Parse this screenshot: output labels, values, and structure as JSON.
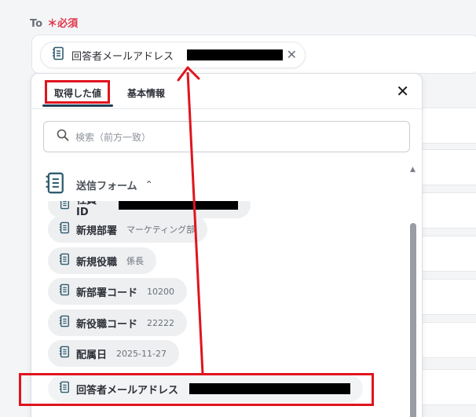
{
  "field": {
    "label": "To",
    "required": "＊必須"
  },
  "to_chip": {
    "label": "回答者メールアドレス",
    "icon": "spreadsheet-icon"
  },
  "tabs": [
    {
      "label": "取得した値"
    },
    {
      "label": "基本情報"
    }
  ],
  "search": {
    "placeholder": "検索（前方一致）"
  },
  "section": {
    "label": "送信フォーム"
  },
  "items": [
    {
      "name": "社員ID",
      "value": ""
    },
    {
      "name": "新規部署",
      "value": "マーケティング部"
    },
    {
      "name": "新規役職",
      "value": "係長"
    },
    {
      "name": "新部署コード",
      "value": "10200"
    },
    {
      "name": "新役職コード",
      "value": "22222"
    },
    {
      "name": "配属日",
      "value": "2025-11-27"
    },
    {
      "name": "回答者メールアドレス",
      "value": ""
    }
  ],
  "colors": {
    "highlight": "#e0141e",
    "tab_underline": "#1f3f58",
    "required": "#e0364a"
  }
}
